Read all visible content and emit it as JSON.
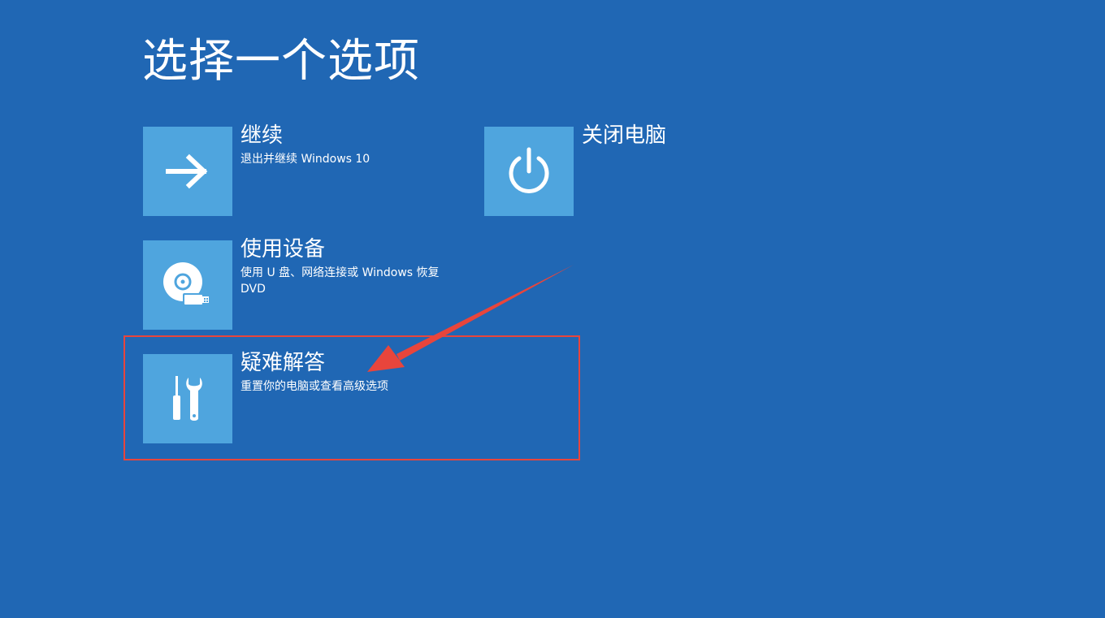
{
  "page": {
    "title": "选择一个选项"
  },
  "options": [
    {
      "id": "continue",
      "label": "继续",
      "description": "退出并继续 Windows 10",
      "icon": "arrow-right-icon"
    },
    {
      "id": "shutdown",
      "label": "关闭电脑",
      "description": "",
      "icon": "power-icon"
    },
    {
      "id": "use-device",
      "label": "使用设备",
      "description": "使用 U 盘、网络连接或 Windows 恢复 DVD",
      "icon": "disc-usb-icon"
    },
    {
      "id": "troubleshoot",
      "label": "疑难解答",
      "description": "重置你的电脑或查看高级选项",
      "icon": "tools-icon"
    }
  ],
  "annotation": {
    "highlighted_option": "troubleshoot",
    "highlight_color": "#e8453c",
    "arrow_color": "#e8453c"
  },
  "colors": {
    "background": "#2067b4",
    "tile": "#4fa5de",
    "text": "#ffffff"
  }
}
